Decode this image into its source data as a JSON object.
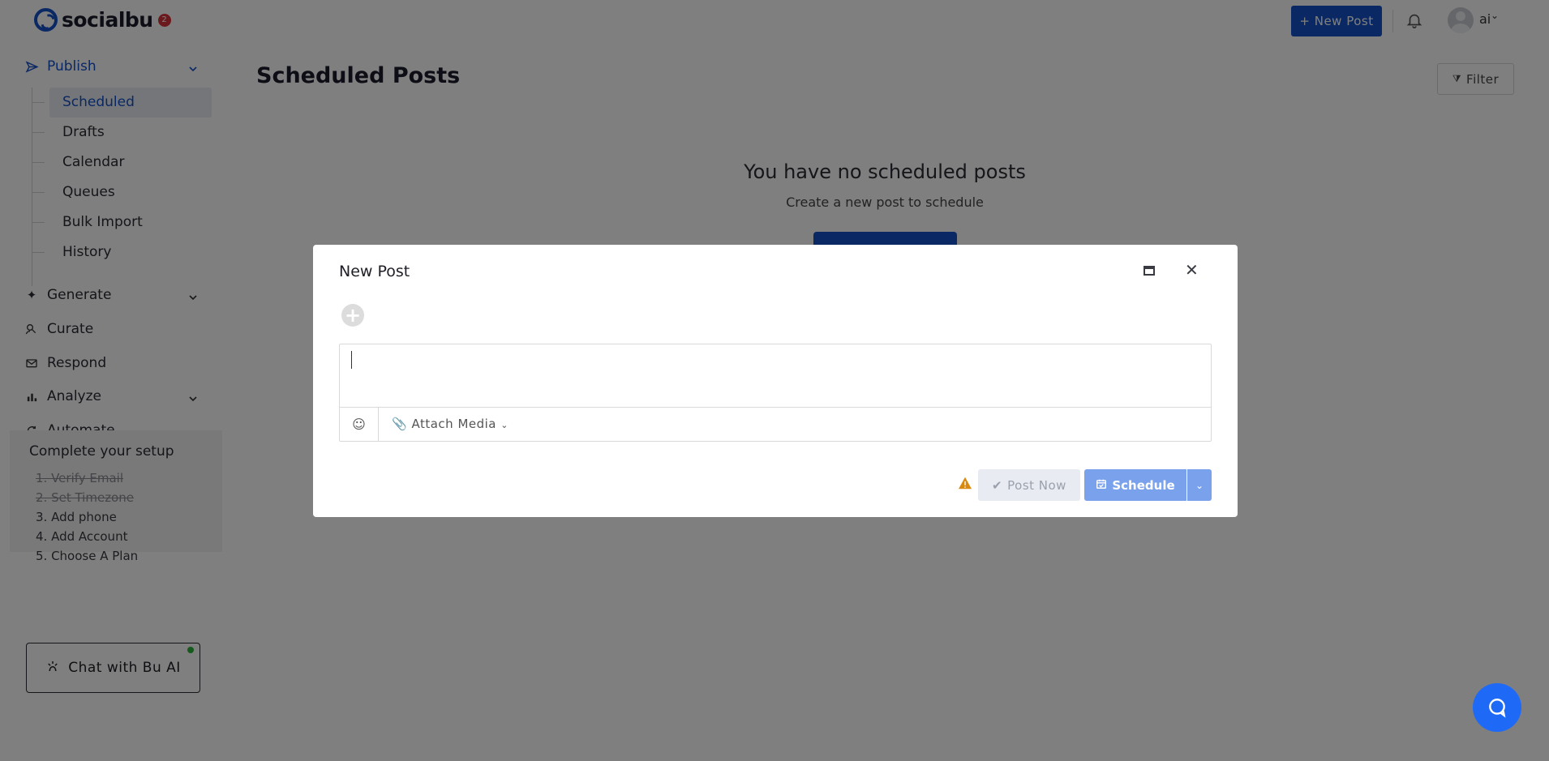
{
  "brand": {
    "name": "socialbu",
    "badge": "2"
  },
  "header": {
    "new_post_label": "+ New Post",
    "user_name": "ai",
    "user_caret": "⌄"
  },
  "sidebar": {
    "publish": "Publish",
    "sub_items": [
      "Scheduled",
      "Drafts",
      "Calendar",
      "Queues",
      "Bulk Import",
      "History"
    ],
    "generate": "Generate",
    "curate": "Curate",
    "respond": "Respond",
    "analyze": "Analyze",
    "automate": "Automate"
  },
  "setup": {
    "title": "Complete your setup",
    "items": [
      "1. Verify Email",
      "2. Set Timezone",
      "3. Add phone",
      "4. Add Account",
      "5. Choose A Plan"
    ]
  },
  "chat": {
    "label": "Chat with Bu AI"
  },
  "main": {
    "title": "Scheduled Posts",
    "filter_label": "Filter",
    "empty_title": "You have no scheduled posts",
    "empty_sub": "Create a new post to schedule"
  },
  "modal": {
    "title": "New Post",
    "attach_label": "Attach Media",
    "post_now_label": "Post Now",
    "schedule_label": "Schedule"
  },
  "colors": {
    "accent": "#1450c7",
    "schedule": "#7aa1ec",
    "warning": "#d9890f",
    "help": "#1e6af7"
  }
}
